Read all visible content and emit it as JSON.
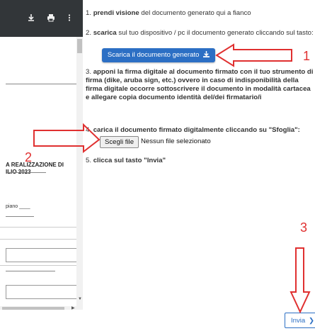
{
  "viewer": {
    "toolbar_icons": [
      "download-icon",
      "print-icon",
      "more-vert-icon"
    ],
    "doc_heading_line1": "A REALIZZAZIONE DI",
    "doc_heading_line2": "ILIO 2023",
    "doc_field_label": "piano ____"
  },
  "steps": [
    {
      "number": "1.",
      "bold": "prendi visione",
      "text": " del documento generato qui a fianco"
    },
    {
      "number": "2.",
      "bold": "scarica",
      "text": " sul tuo dispositivo / pc il documento generato cliccando sul tasto:"
    },
    {
      "number": "3.",
      "text": "apponi la firma digitale al documento firmato con il tuo strumento di firma (dike, aruba sign, etc.) ovvero in caso di indisponibilità della firma digitale occorre sottoscrivere il documento in modalità cartacea e allegare copia documento identità del/dei firmatario/i"
    },
    {
      "number": "4.",
      "text": "carica il documento firmato digitalmente cliccando su \"Sfoglia\":"
    },
    {
      "number": "5.",
      "text": "clicca sul tasto \"Invia\""
    }
  ],
  "download_button": {
    "label": "Scarica il documento generato",
    "icon": "download-icon"
  },
  "file_input": {
    "button_label": "Scegli file",
    "status": "Nessun file selezionato"
  },
  "submit_button": {
    "label": "Invia",
    "icon": "chevron-right-icon"
  },
  "annotations": {
    "color": "#e03030",
    "numbers": [
      "1",
      "2",
      "3"
    ]
  },
  "colors": {
    "accent": "#2c6fc4",
    "annotation": "#e03030",
    "viewer_toolbar": "#323639"
  }
}
